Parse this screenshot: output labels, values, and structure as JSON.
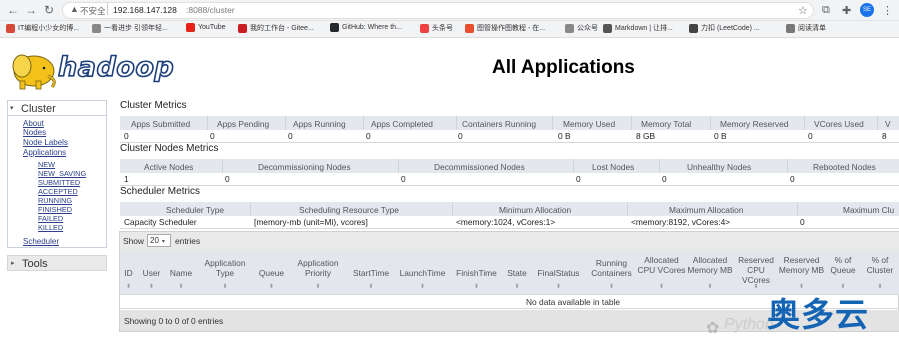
{
  "browser": {
    "insecure_label": "不安全",
    "url_host": "192.168.147.128",
    "url_path": ":8088/cluster",
    "profile": "SE",
    "bookmarks": [
      {
        "label": "IT编程小少女的博...",
        "color": "#d84a38"
      },
      {
        "label": "一看进步 引领年轻...",
        "color": "#888"
      },
      {
        "label": "YouTube",
        "color": "#e62117"
      },
      {
        "label": "我的工作台 - Gitee...",
        "color": "#c71d23"
      },
      {
        "label": "GitHub: Where th...",
        "color": "#24292e"
      },
      {
        "label": "头条号",
        "color": "#f04142"
      },
      {
        "label": "图管操作图教程 - 在...",
        "color": "#e84e2b"
      },
      {
        "label": "公众号",
        "color": "#888"
      },
      {
        "label": "Markdown | 让排...",
        "color": "#555"
      },
      {
        "label": "力扣 (LeetCode) ...",
        "color": "#444"
      },
      {
        "label": "阅读清单",
        "color": "#777"
      }
    ]
  },
  "header": {
    "logo_text": "hadoop",
    "title": "All Applications"
  },
  "sidebar": {
    "cluster_label": "Cluster",
    "links": [
      "About",
      "Nodes",
      "Node Labels",
      "Applications"
    ],
    "states": [
      "NEW",
      "NEW_SAVING",
      "SUBMITTED",
      "ACCEPTED",
      "RUNNING",
      "FINISHED",
      "FAILED",
      "KILLED"
    ],
    "scheduler_label": "Scheduler",
    "tools_label": "Tools"
  },
  "cluster_metrics": {
    "title": "Cluster Metrics",
    "headers": [
      "Apps Submitted",
      "Apps Pending",
      "Apps Running",
      "Apps Completed",
      "Containers Running",
      "Memory Used",
      "Memory Total",
      "Memory Reserved",
      "VCores Used",
      "V"
    ],
    "values": [
      "0",
      "0",
      "0",
      "0",
      "0",
      "0 B",
      "8 GB",
      "0 B",
      "0",
      "8"
    ]
  },
  "nodes_metrics": {
    "title": "Cluster Nodes Metrics",
    "headers": [
      "Active Nodes",
      "Decommissioning Nodes",
      "Decommissioned Nodes",
      "Lost Nodes",
      "Unhealthy Nodes",
      "Rebooted Nodes"
    ],
    "values": [
      "1",
      "0",
      "0",
      "0",
      "0",
      "0"
    ]
  },
  "scheduler_metrics": {
    "title": "Scheduler Metrics",
    "headers": [
      "Scheduler Type",
      "Scheduling Resource Type",
      "Minimum Allocation",
      "Maximum Allocation",
      "Maximum Clu"
    ],
    "values": [
      "Capacity Scheduler",
      "[memory-mb (unit=Mi), vcores]",
      "<memory:1024, vCores:1>",
      "<memory:8192, vCores:4>",
      "0"
    ]
  },
  "apps_table": {
    "show_label": "Show",
    "entries_value": "20",
    "entries_label": "entries",
    "columns": [
      "ID",
      "User",
      "Name",
      "Application Type",
      "Queue",
      "Application Priority",
      "StartTime",
      "LaunchTime",
      "FinishTime",
      "State",
      "FinalStatus",
      "Running Containers",
      "Allocated CPU VCores",
      "Allocated Memory MB",
      "Reserved CPU VCores",
      "Reserved Memory MB",
      "% of Queue",
      "% of Cluster"
    ],
    "empty_message": "No data available in table",
    "footer": "Showing 0 to 0 of 0 entries"
  },
  "watermark": {
    "brand": "奥多云",
    "python": "Python"
  }
}
